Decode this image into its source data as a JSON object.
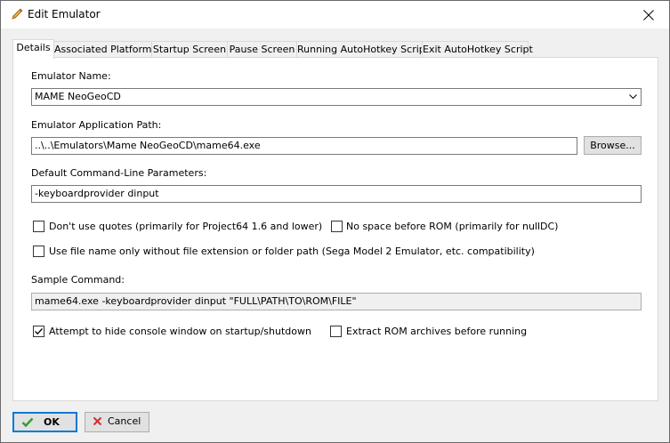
{
  "window": {
    "title": "Edit Emulator",
    "icon": "pencil-icon",
    "close_icon": "close-icon"
  },
  "tabs": [
    {
      "label": "Details",
      "active": true
    },
    {
      "label": "Associated Platforms",
      "active": false
    },
    {
      "label": "Startup Screen",
      "active": false
    },
    {
      "label": "Pause Screen",
      "active": false
    },
    {
      "label": "Running AutoHotkey Script",
      "active": false
    },
    {
      "label": "Exit AutoHotkey Script",
      "active": false
    }
  ],
  "details": {
    "emulator_name_label": "Emulator Name:",
    "emulator_name_value": "MAME NeoGeoCD",
    "app_path_label": "Emulator Application Path:",
    "app_path_value": "..\\..\\Emulators\\Mame NeoGeoCD\\mame64.exe",
    "browse_label": "Browse...",
    "cmdline_label": "Default Command-Line Parameters:",
    "cmdline_value": "-keyboardprovider dinput",
    "checkboxes": {
      "no_quotes": {
        "label": "Don't use quotes (primarily for Project64 1.6 and lower)",
        "checked": false
      },
      "no_space": {
        "label": "No space before ROM (primarily for nullDC)",
        "checked": false
      },
      "file_name_only": {
        "label": "Use file name only without file extension or folder path (Sega Model 2 Emulator, etc. compatibility)",
        "checked": false
      },
      "hide_console": {
        "label": "Attempt to hide console window on startup/shutdown",
        "checked": true
      },
      "extract_rom": {
        "label": "Extract ROM archives before running",
        "checked": false
      }
    },
    "sample_label": "Sample Command:",
    "sample_value": "mame64.exe -keyboardprovider dinput \"FULL\\PATH\\TO\\ROM\\FILE\""
  },
  "footer": {
    "ok_label": "OK",
    "ok_icon": "checkmark-icon",
    "cancel_label": "Cancel",
    "cancel_icon": "cancel-x-icon"
  },
  "colors": {
    "accent": "#0078d7",
    "ok_check": "#2e9e2e",
    "cancel_x": "#d32f2f"
  }
}
